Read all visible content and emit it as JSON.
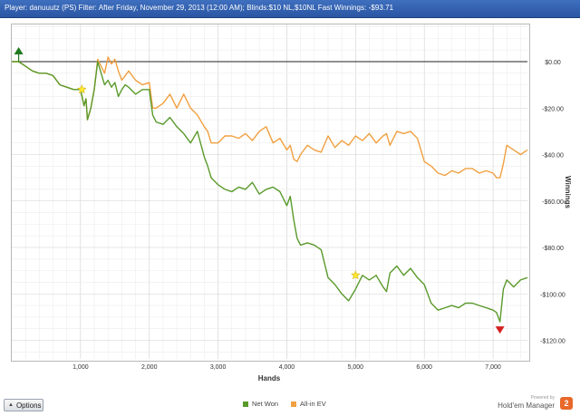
{
  "header": {
    "title": "Player: danuuutz (PS)  Filter:  After Friday, November 29, 2013 (12:00 AM); Blinds:$10 NL,$10NL Fast  Winnings: -$93.71"
  },
  "options_button": {
    "label": "Options"
  },
  "legend": {
    "net_won": "Net Won",
    "allin_ev": "All-in EV"
  },
  "brand": {
    "powered": "Powered by",
    "name": "Hold'em Manager",
    "badge": "2"
  },
  "chart_data": {
    "type": "line",
    "xlabel": "Hands",
    "ylabel": "Winnings",
    "xlim": [
      0,
      7500
    ],
    "ylim": [
      -128,
      16
    ],
    "x_ticks": [
      1000,
      2000,
      3000,
      4000,
      5000,
      6000,
      7000
    ],
    "x_tick_labels": [
      "1,000",
      "2,000",
      "3,000",
      "4,000",
      "5,000",
      "6,000",
      "7,000"
    ],
    "y_ticks": [
      0,
      -20,
      -40,
      -60,
      -80,
      -100,
      -120
    ],
    "y_tick_labels": [
      "$0.00",
      "-$20.00",
      "-$40.00",
      "-$60.00",
      "-$80.00",
      "-$100.00",
      "-$120.00"
    ],
    "grid": true,
    "legend_position": "bottom-center",
    "colors": {
      "net_won": "#5a9a2b",
      "allin_ev": "#f0a040",
      "zero_line": "#222222",
      "max_marker": "#1f7a1f",
      "min_marker": "#d42020",
      "star": "#ffe830"
    },
    "series": [
      {
        "name": "Net Won",
        "x": [
          0,
          100,
          200,
          300,
          400,
          500,
          600,
          700,
          800,
          900,
          1000,
          1050,
          1080,
          1100,
          1150,
          1200,
          1250,
          1300,
          1350,
          1400,
          1450,
          1500,
          1550,
          1600,
          1650,
          1700,
          1800,
          1900,
          2000,
          2050,
          2100,
          2200,
          2300,
          2400,
          2500,
          2600,
          2700,
          2800,
          2850,
          2900,
          3000,
          3100,
          3200,
          3300,
          3400,
          3500,
          3600,
          3700,
          3800,
          3900,
          4000,
          4050,
          4100,
          4150,
          4200,
          4300,
          4400,
          4500,
          4600,
          4700,
          4800,
          4900,
          5000,
          5100,
          5200,
          5300,
          5400,
          5450,
          5500,
          5600,
          5700,
          5800,
          5900,
          6000,
          6100,
          6200,
          6300,
          6400,
          6500,
          6600,
          6700,
          6800,
          6900,
          7000,
          7050,
          7100,
          7150,
          7200,
          7300,
          7400,
          7500
        ],
        "values": [
          0,
          0,
          -2,
          -4,
          -5,
          -5,
          -6,
          -10,
          -11,
          -12,
          -12,
          -19,
          -16,
          -25,
          -20,
          -12,
          0,
          -5,
          -10,
          -8,
          -11,
          -9,
          -15,
          -12,
          -10,
          -11,
          -14,
          -12,
          -12,
          -23,
          -26,
          -27,
          -24,
          -28,
          -31,
          -35,
          -30,
          -41,
          -45,
          -50,
          -53,
          -55,
          -56,
          -54,
          -55,
          -52,
          -57,
          -55,
          -54,
          -56,
          -62,
          -58,
          -68,
          -76,
          -79,
          -78,
          -79,
          -81,
          -93,
          -96,
          -100,
          -103,
          -98,
          -92,
          -94,
          -92,
          -97,
          -99,
          -91,
          -88,
          -92,
          -89,
          -93,
          -96,
          -104,
          -107,
          -106,
          -105,
          -106,
          -104,
          -104,
          -105,
          -106,
          -107,
          -108,
          -112,
          -98,
          -94,
          -97,
          -94,
          -93
        ]
      },
      {
        "name": "All-in EV",
        "x": [
          0,
          100,
          200,
          300,
          400,
          500,
          600,
          700,
          800,
          900,
          1000,
          1050,
          1080,
          1100,
          1150,
          1200,
          1250,
          1300,
          1350,
          1400,
          1450,
          1500,
          1550,
          1600,
          1650,
          1700,
          1800,
          1900,
          2000,
          2050,
          2100,
          2200,
          2300,
          2400,
          2500,
          2600,
          2700,
          2800,
          2850,
          2900,
          3000,
          3100,
          3200,
          3300,
          3400,
          3500,
          3600,
          3700,
          3800,
          3900,
          4000,
          4050,
          4100,
          4150,
          4200,
          4300,
          4400,
          4500,
          4600,
          4700,
          4800,
          4900,
          5000,
          5100,
          5200,
          5300,
          5400,
          5450,
          5500,
          5600,
          5700,
          5800,
          5900,
          6000,
          6100,
          6200,
          6300,
          6400,
          6500,
          6600,
          6700,
          6800,
          6900,
          7000,
          7050,
          7100,
          7150,
          7200,
          7300,
          7400,
          7500
        ],
        "values": [
          0,
          0,
          -2,
          -4,
          -5,
          -5,
          -6,
          -10,
          -11,
          -12,
          -12,
          -19,
          -16,
          -25,
          -20,
          -12,
          1,
          -2,
          -5,
          2,
          -1,
          1,
          -4,
          -8,
          -6,
          -4,
          -8,
          -10,
          -9,
          -20,
          -20,
          -18,
          -14,
          -20,
          -14,
          -20,
          -23,
          -28,
          -30,
          -35,
          -35,
          -32,
          -32,
          -33,
          -31,
          -34,
          -30,
          -28,
          -35,
          -33,
          -38,
          -36,
          -42,
          -43,
          -40,
          -36,
          -38,
          -39,
          -32,
          -37,
          -34,
          -36,
          -32,
          -34,
          -31,
          -35,
          -32,
          -31,
          -36,
          -30,
          -31,
          -30,
          -33,
          -43,
          -45,
          -48,
          -49,
          -47,
          -48,
          -46,
          -46,
          -48,
          -47,
          -48,
          -50,
          -50,
          -44,
          -36,
          -38,
          -40,
          -38
        ]
      }
    ],
    "markers": [
      {
        "type": "max",
        "x": 100,
        "y": 0
      },
      {
        "type": "star",
        "x": 1020,
        "y": -12
      },
      {
        "type": "star",
        "x": 5000,
        "y": -92
      },
      {
        "type": "min",
        "x": 7100,
        "y": -114
      }
    ]
  }
}
